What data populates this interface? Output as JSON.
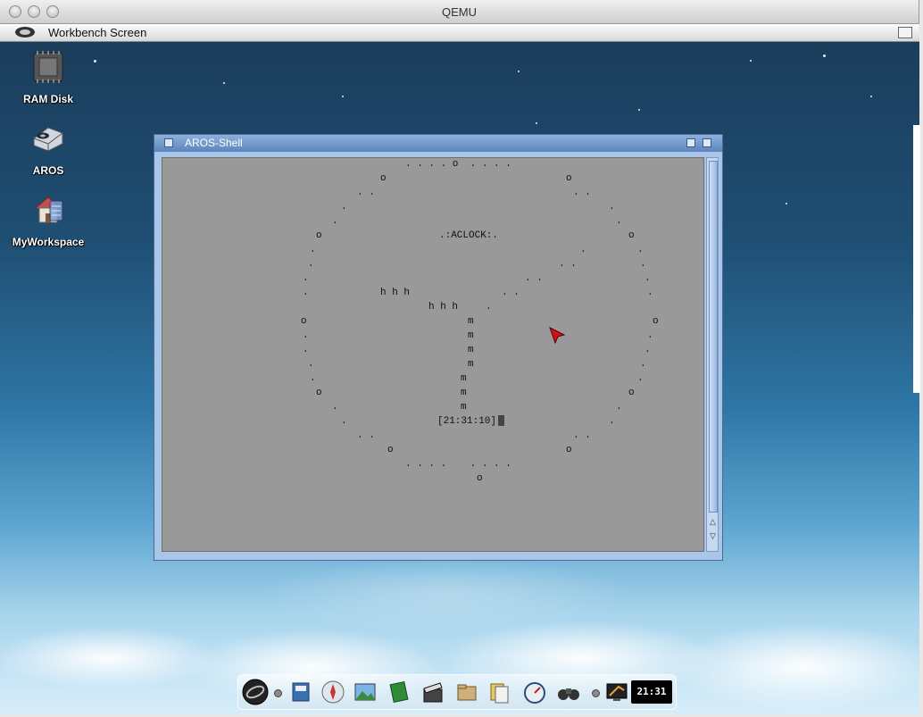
{
  "host_window": {
    "title": "QEMU"
  },
  "screen_bar": {
    "title": "Workbench Screen"
  },
  "desktop_icons": [
    {
      "label": "RAM Disk",
      "icon": "ram-disk-chip-icon"
    },
    {
      "label": "AROS",
      "icon": "drive-icon"
    },
    {
      "label": "MyWorkspace",
      "icon": "workspace-house-icon"
    }
  ],
  "shell_window": {
    "title": "AROS-Shell",
    "aclock_label": ".:ACLOCK:.",
    "time": "[21:31:10]",
    "clock_state": {
      "hours": 21,
      "minutes": 31,
      "seconds": 10
    }
  },
  "dock": {
    "clock": "21:31",
    "items": [
      "aros-logo-icon",
      "docs-icon",
      "compass-icon",
      "picture-icon",
      "book-icon",
      "clapper-icon",
      "folder-icon",
      "files-icon",
      "speedometer-icon",
      "binoculars-icon",
      "display-icon"
    ]
  }
}
